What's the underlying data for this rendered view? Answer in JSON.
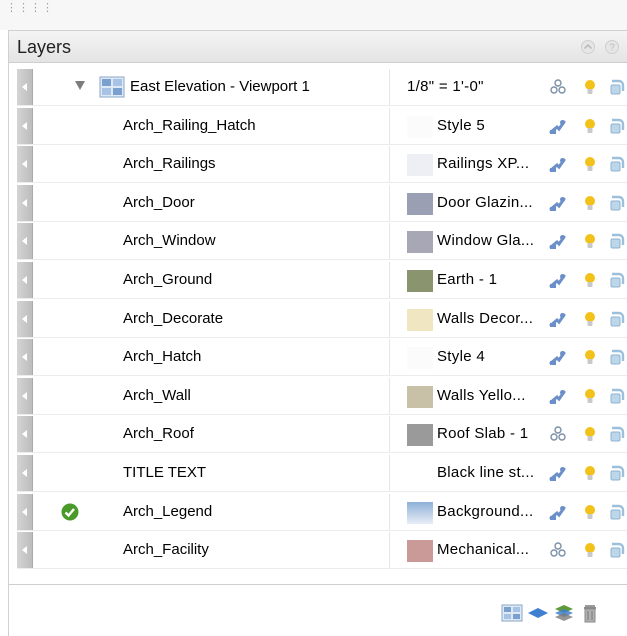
{
  "panel": {
    "title": "Layers"
  },
  "viewport": {
    "label": "East Elevation - Viewport 1",
    "scale": "1/8\" = 1'-0\""
  },
  "layers": [
    {
      "name": "Arch_Railing_Hatch",
      "material": "Style 5",
      "swatch": "#fbfbfb",
      "link": "plug",
      "active": false
    },
    {
      "name": "Arch_Railings",
      "material": "Railings XP...",
      "swatch": "#eeeef5",
      "link": "plug",
      "active": false
    },
    {
      "name": "Arch_Door",
      "material": "Door Glazin...",
      "swatch": "#9a9fb4",
      "link": "plug",
      "active": false
    },
    {
      "name": "Arch_Window",
      "material": "Window Gla...",
      "swatch": "#a8a7b5",
      "link": "plug",
      "active": false
    },
    {
      "name": "Arch_Ground",
      "material": "Earth - 1",
      "swatch": "#8a9570",
      "link": "plug",
      "active": false
    },
    {
      "name": "Arch_Decorate",
      "material": "Walls Decor...",
      "swatch": "#f1e6c2",
      "link": "plug",
      "active": false
    },
    {
      "name": "Arch_Hatch",
      "material": "Style 4",
      "swatch": "#fbfbfb",
      "link": "plug",
      "active": false
    },
    {
      "name": "Arch_Wall",
      "material": "Walls Yello...",
      "swatch": "#c9c0a8",
      "link": "plug",
      "active": false
    },
    {
      "name": "Arch_Roof",
      "material": "Roof Slab - 1",
      "swatch": "#9a9a9a",
      "link": "nodes",
      "active": false
    },
    {
      "name": "TITLE TEXT",
      "material": "Black line st...",
      "swatch": "#ffffff",
      "link": "plug",
      "active": false
    },
    {
      "name": "Arch_Legend",
      "material": "Background...",
      "swatch": "gradient",
      "link": "plug",
      "active": true
    },
    {
      "name": "Arch_Facility",
      "material": "Mechanical...",
      "swatch": "#c99a98",
      "link": "nodes",
      "active": false
    }
  ],
  "colors": {
    "plug": "#6b8fc9",
    "bulb": "#f2c21b",
    "check": "#4a9a2a",
    "nodes": "#7a8fa8"
  }
}
